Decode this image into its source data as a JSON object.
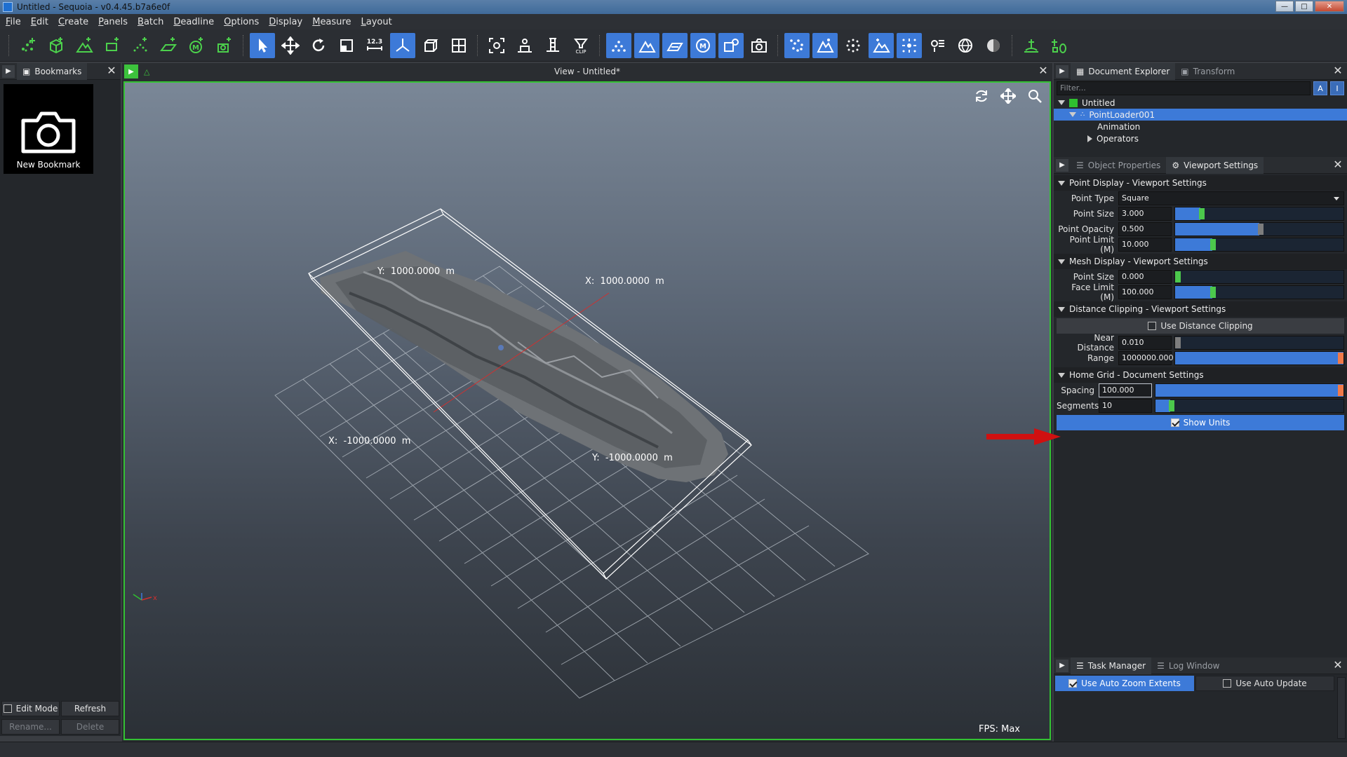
{
  "window": {
    "title": "Untitled - Sequoia - v0.4.45.b7a6e0f"
  },
  "menu": [
    "File",
    "Edit",
    "Create",
    "Panels",
    "Batch",
    "Deadline",
    "Options",
    "Display",
    "Measure",
    "Layout"
  ],
  "toolbar": {
    "measure_label": "12.3",
    "clip_label": "CLIP",
    "m_label": "M"
  },
  "bookmarks": {
    "tab_label": "Bookmarks",
    "new_bookmark_label": "New Bookmark",
    "edit_mode_label": "Edit Mode",
    "refresh_label": "Refresh",
    "rename_label": "Rename...",
    "delete_label": "Delete"
  },
  "viewport": {
    "title": "View - Untitled*",
    "fps_label": "FPS:  Max",
    "axis_labels": {
      "y_pos": "Y:  1000.0000  m",
      "x_pos": "X:  1000.0000  m",
      "x_neg": "X:  -1000.0000  m",
      "y_neg": "Y:  -1000.0000  m"
    }
  },
  "document_explorer": {
    "tab_label": "Document Explorer",
    "transform_tab": "Transform",
    "filter_placeholder": "Filter...",
    "filter_btn_a": "A",
    "filter_btn_i": "I",
    "tree": {
      "root": "Untitled",
      "child": "PointLoader001",
      "animation": "Animation",
      "operators": "Operators"
    }
  },
  "settings_tabs": {
    "object_properties": "Object Properties",
    "viewport_settings": "Viewport Settings"
  },
  "point_display": {
    "title": "Point Display - Viewport Settings",
    "point_type_label": "Point Type",
    "point_type_value": "Square",
    "point_size_label": "Point Size",
    "point_size_value": "3.000",
    "point_opacity_label": "Point Opacity",
    "point_opacity_value": "0.500",
    "point_limit_label": "Point Limit (M)",
    "point_limit_value": "10.000"
  },
  "mesh_display": {
    "title": "Mesh Display - Viewport Settings",
    "point_size_label": "Point Size",
    "point_size_value": "0.000",
    "face_limit_label": "Face Limit (M)",
    "face_limit_value": "100.000"
  },
  "distance_clipping": {
    "title": "Distance Clipping - Viewport Settings",
    "use_label": "Use Distance Clipping",
    "near_label": "Near Distance",
    "near_value": "0.010",
    "range_label": "Range",
    "range_value": "1000000.000"
  },
  "home_grid": {
    "title": "Home Grid - Document Settings",
    "spacing_label": "Spacing",
    "spacing_value": "100.000",
    "segments_label": "Segments",
    "segments_value": "10",
    "show_units_label": "Show Units"
  },
  "task_manager": {
    "tab_label": "Task Manager",
    "log_tab": "Log Window",
    "auto_zoom_label": "Use Auto Zoom Extents",
    "auto_update_label": "Use Auto Update"
  },
  "colors": {
    "accent": "#3d7ad8",
    "viewport_border": "#33c233",
    "arrow": "#d01010"
  }
}
